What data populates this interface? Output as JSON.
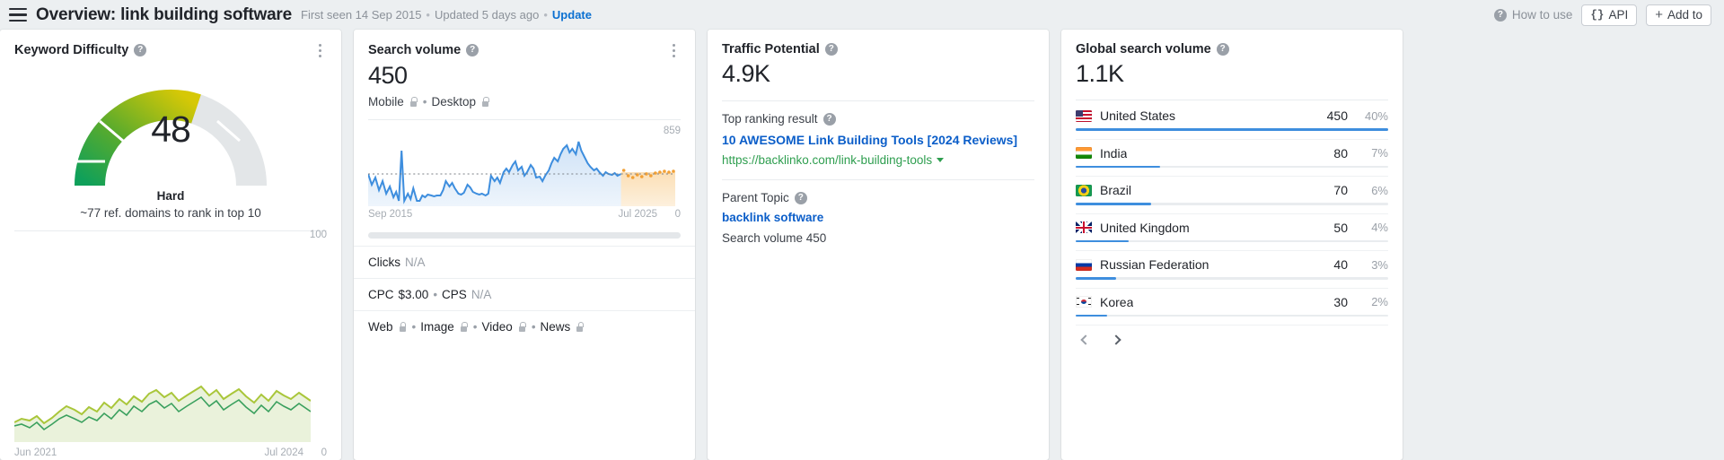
{
  "header": {
    "menu_icon": "hamburger-icon",
    "title": "Overview: link building software",
    "first_seen": "First seen 14 Sep 2015",
    "dot": "•",
    "updated": "Updated 5 days ago",
    "update_link": "Update",
    "how_to_use": "How to use",
    "api_button": "API",
    "api_brace": "{}",
    "add_to_button": "Add to",
    "plus": "+"
  },
  "keyword_difficulty": {
    "title": "Keyword Difficulty",
    "value": "48",
    "label": "Hard",
    "sub": "~77 ref. domains to rank in top 10",
    "axis_max": "100",
    "axis_min": "0",
    "axis_start": "Jun 2021",
    "axis_end": "Jul 2024",
    "gauge_percent": 48,
    "colors": {
      "seg1": "#14a155",
      "seg2": "#5aaa2f",
      "seg3": "#cfc40a",
      "track": "#e3e6e8",
      "line": "#a6c236",
      "fill": "#e8f0d6"
    }
  },
  "search_volume": {
    "title": "Search volume",
    "value": "450",
    "mobile": "Mobile",
    "desktop": "Desktop",
    "sepdot": "•",
    "axis_max": "859",
    "axis_min": "0",
    "axis_start": "Sep 2015",
    "axis_end": "Jul 2025",
    "clicks_label": "Clicks",
    "clicks_value": "N/A",
    "cpc_label": "CPC",
    "cpc_value": "$3.00",
    "cps_label": "CPS",
    "cps_value": "N/A",
    "serp_web": "Web",
    "serp_image": "Image",
    "serp_video": "Video",
    "serp_news": "News",
    "colors": {
      "line": "#3e8ede",
      "fill": "#d6e6f7",
      "forecast": "#f5a623",
      "forecast_fill": "#fde3c0"
    }
  },
  "traffic_potential": {
    "title": "Traffic Potential",
    "value": "4.9K",
    "top_ranking_label": "Top ranking result",
    "top_ranking_title": "10 AWESOME Link Building Tools [2024 Reviews]",
    "top_ranking_url": "https://backlinko.com/link-building-tools",
    "parent_topic_label": "Parent Topic",
    "parent_topic_value": "backlink software",
    "parent_search_volume": "Search volume 450"
  },
  "global_search_volume": {
    "title": "Global search volume",
    "value": "1.1K",
    "countries": [
      {
        "name": "United States",
        "volume": "450",
        "percent": "40%",
        "bar": 100,
        "flag": "us"
      },
      {
        "name": "India",
        "volume": "80",
        "percent": "7%",
        "bar": 27,
        "flag": "in"
      },
      {
        "name": "Brazil",
        "volume": "70",
        "percent": "6%",
        "bar": 24,
        "flag": "br"
      },
      {
        "name": "United Kingdom",
        "volume": "50",
        "percent": "4%",
        "bar": 17,
        "flag": "gb"
      },
      {
        "name": "Russian Federation",
        "volume": "40",
        "percent": "3%",
        "bar": 13,
        "flag": "ru"
      },
      {
        "name": "Korea",
        "volume": "30",
        "percent": "2%",
        "bar": 10,
        "flag": "kr"
      }
    ],
    "prev": "‹",
    "next": "›"
  },
  "chart_data": [
    {
      "type": "line",
      "title": "Keyword Difficulty history",
      "xlabel": "",
      "ylabel": "",
      "ylim": [
        0,
        100
      ],
      "x": [
        "Jun 2021",
        "Jul 2024"
      ],
      "tick_labels": [
        "Jun 2021",
        "Jul 2024"
      ],
      "y_ticks": [
        "0",
        "100"
      ],
      "grid": false,
      "legend": "none",
      "values": [
        38,
        36,
        37,
        35,
        39,
        37,
        41,
        44,
        42,
        40,
        43,
        41,
        45,
        43,
        46,
        44,
        47,
        45,
        48,
        50,
        47,
        49,
        46,
        48,
        50,
        52,
        49,
        51,
        48,
        50,
        52,
        49,
        47,
        50,
        48,
        52,
        50,
        49,
        51,
        48
      ]
    },
    {
      "type": "area",
      "title": "Search volume history",
      "xlabel": "",
      "ylabel": "",
      "ylim": [
        0,
        859
      ],
      "x": [
        "Sep 2015",
        "Jul 2025"
      ],
      "tick_labels": [
        "Sep 2015",
        "Jul 2025"
      ],
      "y_ticks": [
        "0",
        "859"
      ],
      "grid": false,
      "legend": "none",
      "series": [
        {
          "name": "Search volume",
          "values": [
            430,
            300,
            260,
            320,
            200,
            130,
            820,
            160,
            110,
            300,
            450,
            120,
            100,
            130,
            140,
            150,
            160,
            150,
            140,
            130,
            140,
            130,
            130,
            135,
            130,
            300,
            260,
            290,
            250,
            160,
            150,
            170,
            280,
            240,
            180,
            160,
            150,
            155,
            140,
            150,
            420,
            330,
            380,
            310,
            450,
            520,
            460,
            560,
            610,
            480,
            520,
            380,
            420,
            390,
            460,
            420,
            330,
            340,
            300,
            350,
            420,
            520,
            600,
            560,
            640,
            700,
            760,
            680,
            720,
            660,
            859,
            700,
            620,
            560,
            520,
            480,
            500,
            460,
            430,
            470,
            450,
            440,
            460,
            430,
            450
          ]
        },
        {
          "name": "Forecast",
          "values": [
            455,
            430,
            470,
            440,
            425,
            430,
            450,
            465,
            445,
            450,
            460,
            455
          ]
        }
      ]
    },
    {
      "type": "bar",
      "title": "Global search volume by country",
      "categories": [
        "United States",
        "India",
        "Brazil",
        "United Kingdom",
        "Russian Federation",
        "Korea"
      ],
      "values": [
        450,
        80,
        70,
        50,
        40,
        30
      ],
      "percents": [
        40,
        7,
        6,
        4,
        3,
        2
      ],
      "xlabel": "",
      "ylabel": "",
      "legend": "none"
    }
  ]
}
